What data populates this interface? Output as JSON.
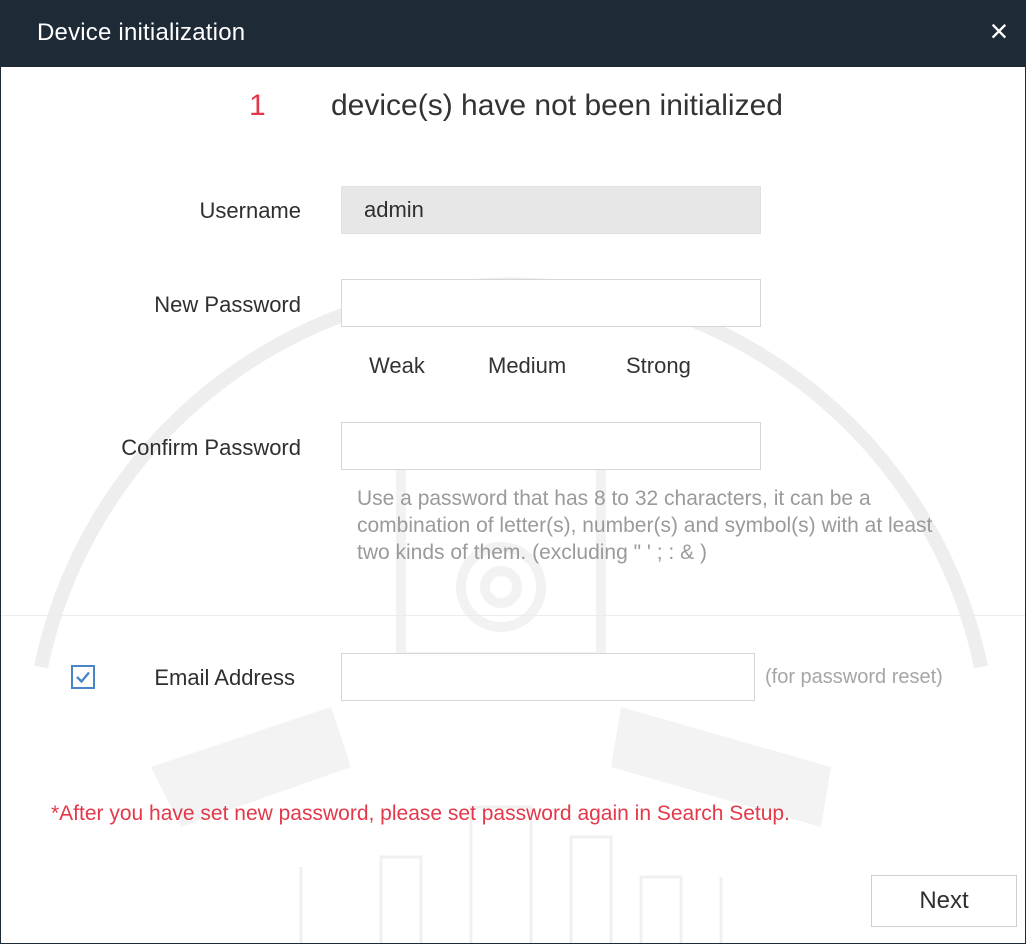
{
  "window": {
    "title": "Device initialization",
    "close_glyph": "×"
  },
  "status": {
    "count": "1",
    "text": "device(s) have not been initialized"
  },
  "form": {
    "username": {
      "label": "Username",
      "value": "admin"
    },
    "new_password": {
      "label": "New Password",
      "value": ""
    },
    "strength": {
      "weak": "Weak",
      "medium": "Medium",
      "strong": "Strong"
    },
    "confirm_password": {
      "label": "Confirm Password",
      "value": ""
    },
    "hint": "Use a password that has 8 to 32 characters, it can be a combination of letter(s), number(s) and symbol(s) with at least two kinds of them. (excluding \" ' ; : & )",
    "email": {
      "label": "Email Address",
      "checked": true,
      "value": "",
      "note": "(for password reset)"
    }
  },
  "warning": "*After you have set new password, please set password again in Search Setup.",
  "actions": {
    "next_label": "Next"
  },
  "colors": {
    "titlebar": "#1f2a37",
    "accent_red": "#e3384a",
    "checkbox_blue": "#4a86c7",
    "input_readonly_bg": "#e7e7e7"
  }
}
